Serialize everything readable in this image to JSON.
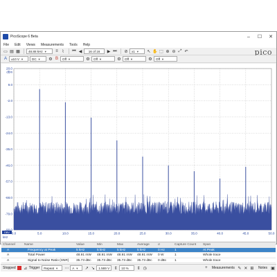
{
  "window": {
    "title": "PicoScope 6 Beta"
  },
  "menu": [
    "File",
    "Edit",
    "Views",
    "Measurements",
    "Tools",
    "Help"
  ],
  "toolbar1": {
    "timebase": "48.88 kHz",
    "capture_counter": "16 of 16",
    "zoom": "x1",
    "brand": "pico"
  },
  "toolbar2": {
    "range": "±10 V",
    "coupling": "DC",
    "channel_b": "B",
    "off_1": "Off",
    "off_2": "Off",
    "off_3": "Off",
    "off_4": "Off"
  },
  "scope": {
    "colors": {
      "trace": "#3a4fa0",
      "grid": "#a5a5a5",
      "axis_text": "#1f3f9a"
    },
    "y_unit": "dBm",
    "x_unit": "kHz",
    "y_ticks": [
      "20.0",
      "9.0",
      "-2.0",
      "-13.0",
      "-24.0",
      "-35.0",
      "-46.0",
      "-57.0",
      "-68.0",
      "-79.0",
      "-90.0"
    ],
    "x_ticks": [
      "0.0",
      "5.0",
      "10.0",
      "15.0",
      "20.0",
      "25.0",
      "30.0",
      "35.0",
      "40.0",
      "45.0",
      "50.0"
    ],
    "ruler": "DBV"
  },
  "chart_data": {
    "type": "line",
    "xlabel": "kHz",
    "ylabel": "dBm",
    "xlim": [
      0,
      50
    ],
    "ylim": [
      -90,
      20
    ],
    "grid": true,
    "noise_floor_dbm": -77,
    "peaks": [
      {
        "x": 5.0,
        "y": 6
      },
      {
        "x": 10.0,
        "y": -3
      },
      {
        "x": 15.0,
        "y": -13.5
      },
      {
        "x": 20.0,
        "y": -29
      },
      {
        "x": 25.0,
        "y": -40
      },
      {
        "x": 30.0,
        "y": -46
      },
      {
        "x": 35.0,
        "y": -50
      },
      {
        "x": 40.0,
        "y": -55
      },
      {
        "x": 45.0,
        "y": -47
      }
    ]
  },
  "measurements": {
    "headers": [
      "Channel",
      "Name",
      "Span",
      "Value",
      "Min",
      "Max",
      "Average",
      "σ",
      "Capture Count"
    ],
    "rows": [
      {
        "channel": "A",
        "name": "Frequency at Peak",
        "span": "At Peak",
        "value": "5 kHz",
        "min": "5 kHz",
        "max": "5 kHz",
        "avg": "5 kHz",
        "sigma": "0 Hz",
        "count": "1"
      },
      {
        "channel": "A",
        "name": "Total Power",
        "span": "Whole trace",
        "value": "48.91 mW",
        "min": "48.91 mW",
        "max": "48.91 mW",
        "avg": "48.91 mW",
        "sigma": "0 W",
        "count": "1"
      },
      {
        "channel": "A",
        "name": "Signal to Noise Ratio (SNR)",
        "span": "Whole trace",
        "value": "35.73 dBc",
        "min": "35.73 dBc",
        "max": "35.73 dBc",
        "avg": "35.73 dBc",
        "sigma": "0 dBc",
        "count": "1"
      }
    ]
  },
  "statusbar": {
    "state": "Stopped",
    "trigger_label": "Trigger",
    "trigger_mode": "Repeat",
    "trigger_source": "A",
    "level": "1.569 V",
    "pretrigger": "10 %",
    "measurements_label": "Measurements",
    "notes_label": "Notes"
  }
}
